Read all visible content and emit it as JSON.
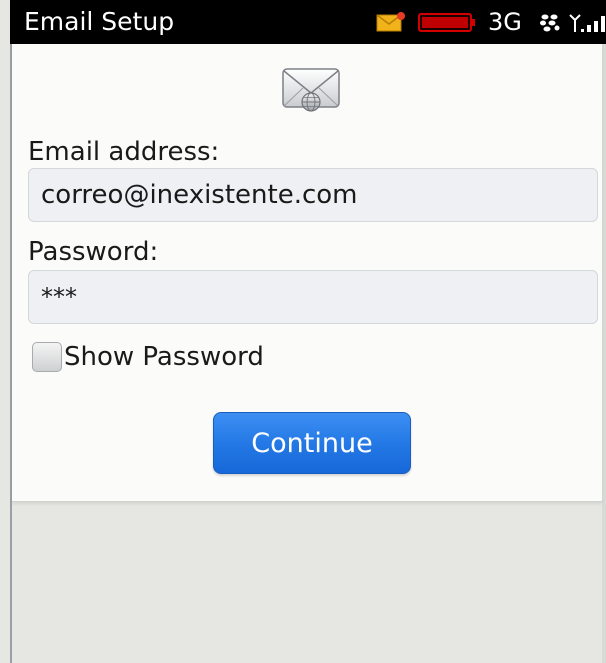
{
  "status_bar": {
    "title": "Email Setup",
    "network": "3G",
    "icons": [
      "new-mail-icon",
      "low-battery-icon",
      "blackberry-icon",
      "signal-strength-icon"
    ],
    "battery_color": "#d40000"
  },
  "form": {
    "icon": "envelope-icon",
    "email_label": "Email address:",
    "email_value": "correo@inexistente.com",
    "password_label": "Password:",
    "password_value": "***",
    "show_password_label": "Show Password",
    "show_password_checked": false,
    "continue_label": "Continue",
    "accent_color": "#2479e6"
  }
}
